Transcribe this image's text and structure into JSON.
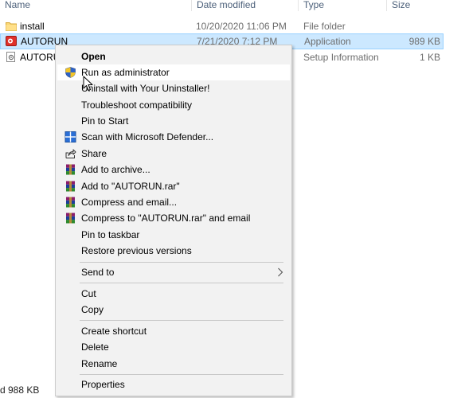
{
  "columns": {
    "name": "Name",
    "date_modified": "Date modified",
    "type": "Type",
    "size": "Size"
  },
  "files": [
    {
      "name": "install",
      "date": "10/20/2020 11:06 PM",
      "type": "File folder",
      "size": "",
      "icon": "folder-icon",
      "selected": false
    },
    {
      "name": "AUTORUN",
      "date": "7/21/2020 7:12 PM",
      "type": "Application",
      "size": "989 KB",
      "icon": "application-icon",
      "selected": true
    },
    {
      "name": "AUTORUN",
      "date": "",
      "type": "Setup Information",
      "size": "1 KB",
      "icon": "setup-info-icon",
      "selected": false
    }
  ],
  "status_bar": {
    "fragment": "d  988 KB"
  },
  "context_menu": {
    "items": [
      {
        "label": "Open",
        "bold": true,
        "icon": ""
      },
      {
        "label": "Run as administrator",
        "icon": "uac-shield-icon",
        "hovered": true
      },
      {
        "label": "Uninstall with Your Uninstaller!",
        "icon": ""
      },
      {
        "label": "Troubleshoot compatibility",
        "icon": ""
      },
      {
        "label": "Pin to Start",
        "icon": ""
      },
      {
        "label": "Scan with Microsoft Defender...",
        "icon": "defender-icon"
      },
      {
        "label": "Share",
        "icon": "share-icon"
      },
      {
        "label": "Add to archive...",
        "icon": "winrar-icon"
      },
      {
        "label": "Add to \"AUTORUN.rar\"",
        "icon": "winrar-icon"
      },
      {
        "label": "Compress and email...",
        "icon": "winrar-icon"
      },
      {
        "label": "Compress to \"AUTORUN.rar\" and email",
        "icon": "winrar-icon"
      },
      {
        "label": "Pin to taskbar",
        "icon": ""
      },
      {
        "label": "Restore previous versions",
        "icon": ""
      },
      {
        "label": "Send to",
        "icon": "",
        "submenu": true
      },
      {
        "label": "Cut",
        "icon": ""
      },
      {
        "label": "Copy",
        "icon": ""
      },
      {
        "label": "Create shortcut",
        "icon": ""
      },
      {
        "label": "Delete",
        "icon": ""
      },
      {
        "label": "Rename",
        "icon": ""
      },
      {
        "label": "Properties",
        "icon": ""
      }
    ]
  },
  "colors": {
    "selection_bg": "#cce8ff",
    "selection_border": "#99d1ff",
    "menu_bg": "#f2f2f2",
    "menu_hover": "#ffffff",
    "header_text": "#4c607a",
    "secondary_text": "#6d6d6d"
  }
}
